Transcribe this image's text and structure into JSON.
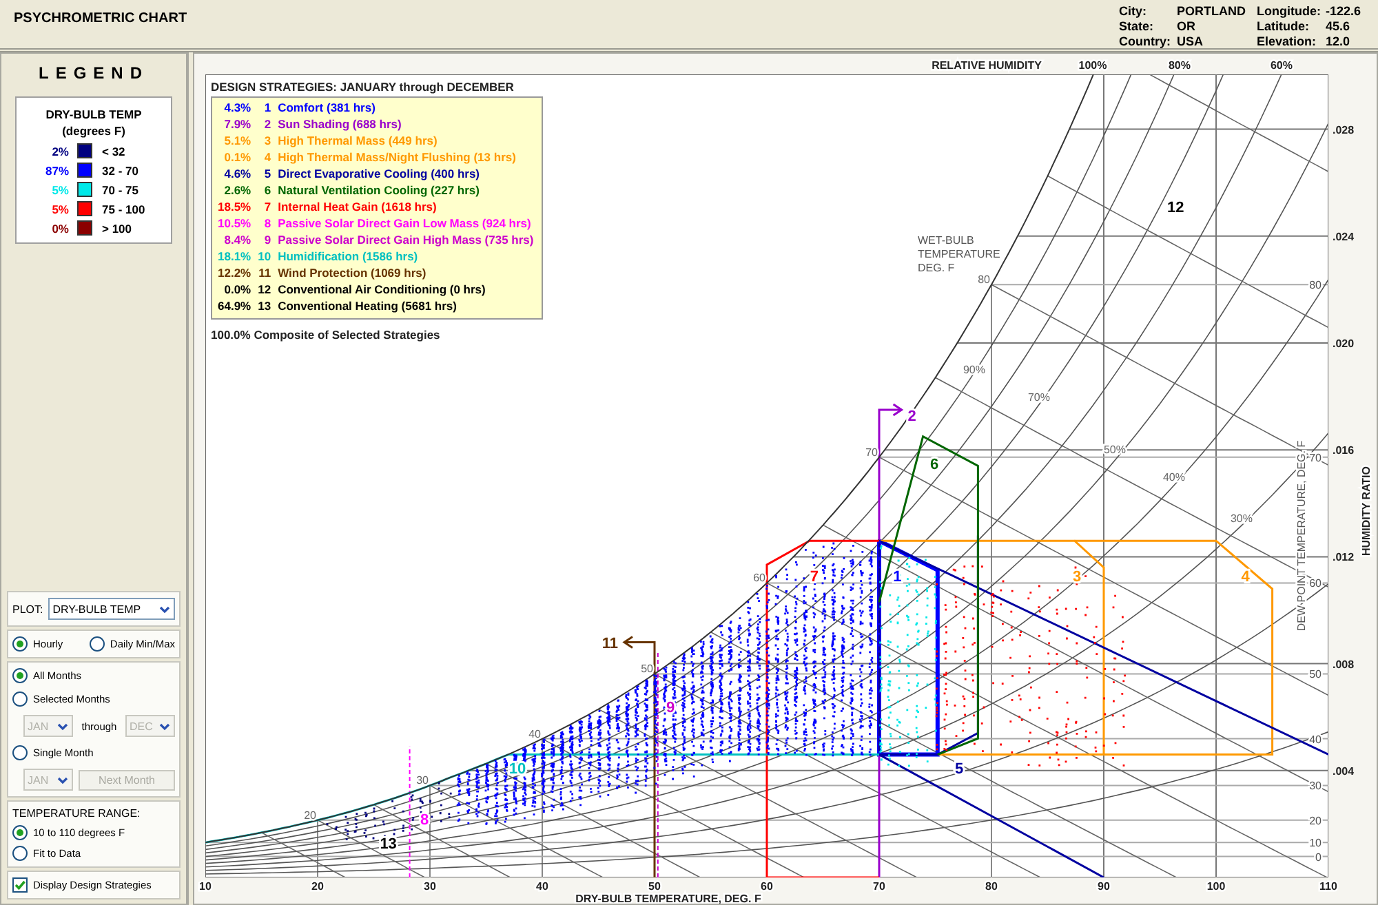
{
  "window": {
    "title": "PSYCHROMETRIC CHART"
  },
  "location": [
    {
      "label": "City:",
      "value": "PORTLAND"
    },
    {
      "label": "State:",
      "value": "OR"
    },
    {
      "label": "Country:",
      "value": "USA"
    }
  ],
  "coordinates": [
    {
      "label": "Longitude:",
      "value": "-122.6"
    },
    {
      "label": "Latitude:",
      "value": "45.6"
    },
    {
      "label": "Elevation:",
      "value": "12.0"
    }
  ],
  "legend": {
    "title": "LEGEND",
    "heading": "DRY-BULB TEMP",
    "units": "(degrees F)",
    "items": [
      {
        "percent": "2%",
        "range": "< 32",
        "color": "#000080"
      },
      {
        "percent": "87%",
        "range": "32  -  70",
        "color": "#0000ff"
      },
      {
        "percent": "5%",
        "range": "70  -  75",
        "color": "#00e8e8"
      },
      {
        "percent": "5%",
        "range": "75  -  100",
        "color": "#ff0000"
      },
      {
        "percent": "0%",
        "range": "> 100",
        "color": "#8b0000"
      }
    ]
  },
  "controls": {
    "plot": {
      "label": "PLOT:",
      "value": "DRY-BULB TEMP"
    },
    "interval": [
      {
        "label": "Hourly",
        "selected": true
      },
      {
        "label": "Daily Min/Max",
        "selected": false
      }
    ],
    "months": [
      {
        "label": "All Months",
        "selected": true
      },
      {
        "label": "Selected Months",
        "selected": false
      },
      {
        "label": "Single Month",
        "selected": false
      }
    ],
    "month_from": {
      "value": "JAN",
      "disabled": true
    },
    "through": "through",
    "month_to": {
      "value": "DEC",
      "disabled": true
    },
    "single_month": {
      "value": "JAN",
      "disabled": true
    },
    "next_month": {
      "label": "Next Month",
      "disabled": true
    },
    "range_title": "TEMPERATURE RANGE:",
    "ranges": [
      {
        "label": "10 to 110 degrees F",
        "selected": true
      },
      {
        "label": "Fit to Data",
        "selected": false
      }
    ],
    "display_strategies": {
      "label": "Display Design Strategies",
      "checked": true
    }
  },
  "strategies": {
    "title": "DESIGN STRATEGIES:  JANUARY through DECEMBER",
    "items": [
      {
        "percent": "4.3%",
        "number": "1",
        "name": "Comfort (381 hrs)",
        "color": "#0000ff",
        "chart_label": "1"
      },
      {
        "percent": "7.9%",
        "number": "2",
        "name": "Sun Shading (688 hrs)",
        "color": "#9900cc",
        "chart_label": "2"
      },
      {
        "percent": "5.1%",
        "number": "3",
        "name": "High Thermal Mass (449 hrs)",
        "color": "#ff9900",
        "chart_label": "3"
      },
      {
        "percent": "0.1%",
        "number": "4",
        "name": "High Thermal Mass/Night Flushing (13 hrs)",
        "color": "#ff9900",
        "chart_label": "4"
      },
      {
        "percent": "4.6%",
        "number": "5",
        "name": "Direct Evaporative Cooling (400 hrs)",
        "color": "#0000a0",
        "chart_label": "5"
      },
      {
        "percent": "2.6%",
        "number": "6",
        "name": "Natural Ventilation Cooling (227 hrs)",
        "color": "#006600",
        "chart_label": "6"
      },
      {
        "percent": "18.5%",
        "number": "7",
        "name": "Internal Heat Gain (1618 hrs)",
        "color": "#ff0000",
        "chart_label": "7"
      },
      {
        "percent": "10.5%",
        "number": "8",
        "name": "Passive Solar Direct Gain Low Mass (924 hrs)",
        "color": "#ff00ff",
        "chart_label": "8"
      },
      {
        "percent": "8.4%",
        "number": "9",
        "name": "Passive Solar Direct Gain High Mass (735 hrs)",
        "color": "#cc00cc",
        "chart_label": "9"
      },
      {
        "percent": "18.1%",
        "number": "10",
        "name": "Humidification (1586 hrs)",
        "color": "#00c0c0",
        "chart_label": "10"
      },
      {
        "percent": "12.2%",
        "number": "11",
        "name": "Wind Protection (1069 hrs)",
        "color": "#663300",
        "chart_label": "11"
      },
      {
        "percent": "0.0%",
        "number": "12",
        "name": "Conventional Air Conditioning (0 hrs)",
        "color": "#000000",
        "chart_label": "12"
      },
      {
        "percent": "64.9%",
        "number": "13",
        "name": "Conventional Heating (5681 hrs)",
        "color": "#000000",
        "chart_label": "13"
      }
    ],
    "composite": "100.0% Composite of Selected Strategies"
  },
  "chart": {
    "top_title": "RELATIVE HUMIDITY",
    "top_rh_labels": [
      "100%",
      "80%",
      "60%"
    ],
    "rh_labels": [
      "90%",
      "70%",
      "50%",
      "40%",
      "30%"
    ],
    "wet_bulb_title": [
      "WET-BULB",
      "TEMPERATURE",
      "DEG. F"
    ],
    "wet_bulb_labels": [
      "20",
      "30",
      "40",
      "50",
      "60",
      "70",
      "80"
    ],
    "dew_point_labels": [
      "80",
      "70",
      "60",
      "50",
      "40",
      "30",
      "20",
      "10",
      "0"
    ],
    "dew_point_title": "DEW POINT TEMPERATURE, DEG. F",
    "humidity_ratio_labels": [
      ".028",
      ".024",
      ".020",
      ".016",
      ".012",
      ".008",
      ".004"
    ],
    "humidity_ratio_title": "HUMIDITY RATIO",
    "x_labels": [
      "10",
      "20",
      "30",
      "40",
      "50",
      "60",
      "70",
      "80",
      "90",
      "100",
      "110"
    ],
    "x_title": "DRY-BULB TEMPERATURE, DEG. F"
  }
}
